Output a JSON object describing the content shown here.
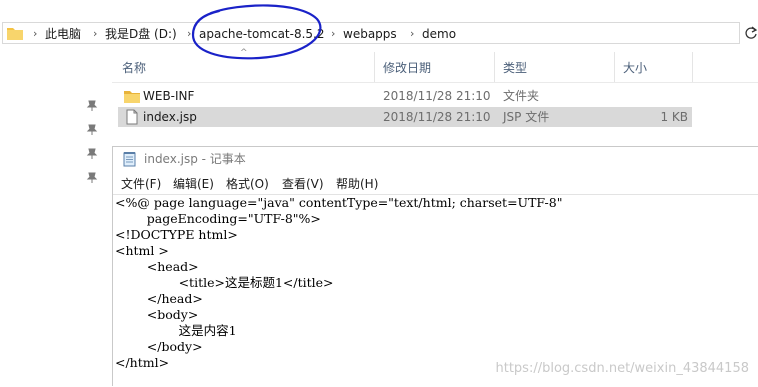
{
  "address": {
    "segments": [
      "此电脑",
      "我是D盘 (D:)",
      "apache-tomcat-8.5.2",
      "webapps",
      "demo"
    ],
    "separator": "›"
  },
  "columns": {
    "name": "名称",
    "modified": "修改日期",
    "type": "类型",
    "size": "大小"
  },
  "files": [
    {
      "name": "WEB-INF",
      "modified": "2018/11/28 21:10",
      "type": "文件夹",
      "size": "",
      "icon": "folder-icon"
    },
    {
      "name": "index.jsp",
      "modified": "2018/11/28 21:10",
      "type": "JSP 文件",
      "size": "1 KB",
      "icon": "document-icon"
    }
  ],
  "notepad": {
    "title": "index.jsp - 记事本",
    "menu": [
      "文件(F)",
      "编辑(E)",
      "格式(O)",
      "查看(V)",
      "帮助(H)"
    ],
    "lines": [
      "<%@ page language=\"java\" contentType=\"text/html; charset=UTF-8\"",
      "        pageEncoding=\"UTF-8\"%>",
      "<!DOCTYPE html>",
      "<html >",
      "        <head>",
      "                <title>这是标题1</title>",
      "        </head>",
      "        <body>",
      "                这是内容1",
      "        </body>",
      "</html>"
    ]
  },
  "watermark": "https://blog.csdn.net/weixin_43844158",
  "colors": {
    "highlight_ring": "#1a22c8",
    "folder": "#f5c342",
    "header_text": "#4c607a",
    "selection": "#d9d9d9"
  }
}
